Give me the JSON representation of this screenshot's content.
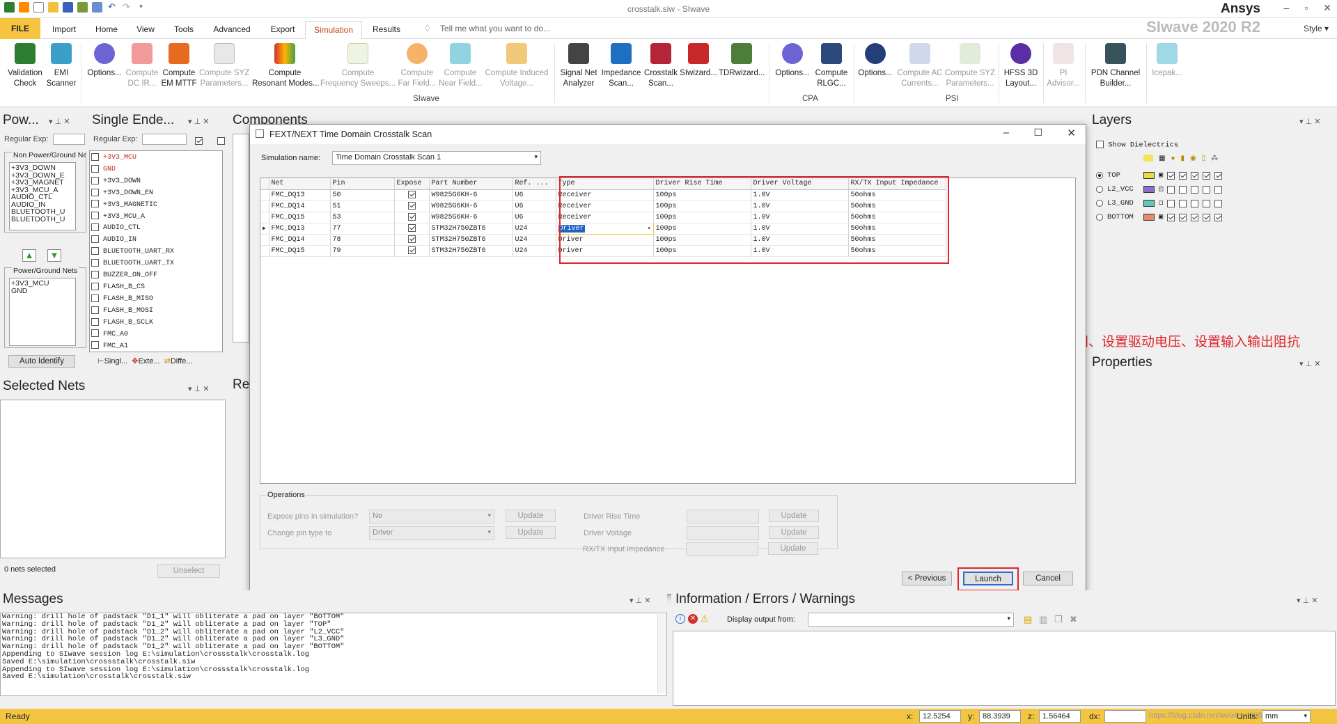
{
  "app": {
    "window_title": "crosstalk.siw - SIwave",
    "brand": "Ansys",
    "product": "SIwave 2020 R2",
    "style_label": "Style"
  },
  "menu": {
    "tabs": [
      "FILE",
      "Import",
      "Home",
      "View",
      "Tools",
      "Advanced",
      "Export",
      "Simulation",
      "Results"
    ],
    "active": "Simulation",
    "tell_me": "Tell me what you want to do..."
  },
  "ribbon": {
    "buttons": [
      {
        "label": "Validation\nCheck",
        "enabled": true,
        "icon": "validation-check-icon"
      },
      {
        "label": "EMI\nScanner",
        "enabled": true,
        "icon": "emi-scanner-icon"
      },
      {
        "label": "Options...",
        "enabled": true,
        "icon": "options-icon"
      },
      {
        "label": "Compute\nDC IR...",
        "enabled": false,
        "icon": "dc-ir-icon"
      },
      {
        "label": "Compute\nEM MTTF",
        "enabled": true,
        "icon": "em-mttf-icon"
      },
      {
        "label": "Compute SYZ\nParameters...",
        "enabled": false,
        "icon": "syz-icon"
      },
      {
        "label": "Compute\nResonant Modes...",
        "enabled": true,
        "icon": "resonant-modes-icon"
      },
      {
        "label": "Compute\nFrequency Sweeps...",
        "enabled": false,
        "icon": "frequency-sweep-icon"
      },
      {
        "label": "Compute\nFar Field...",
        "enabled": false,
        "icon": "far-field-icon"
      },
      {
        "label": "Compute\nNear Field...",
        "enabled": false,
        "icon": "near-field-icon"
      },
      {
        "label": "Compute Induced\nVoltage...",
        "enabled": false,
        "icon": "induced-voltage-icon"
      },
      {
        "label": "Signal Net\nAnalyzer",
        "enabled": true,
        "icon": "signal-net-analyzer-icon"
      },
      {
        "label": "Impedance\nScan...",
        "enabled": true,
        "icon": "impedance-scan-icon"
      },
      {
        "label": "Crosstalk\nScan...",
        "enabled": true,
        "icon": "crosstalk-scan-icon"
      },
      {
        "label": "SIwizard...",
        "enabled": true,
        "icon": "siwizard-icon"
      },
      {
        "label": "TDRwizard...",
        "enabled": true,
        "icon": "tdrwizard-icon"
      },
      {
        "label": "Options...",
        "enabled": true,
        "icon": "cpa-options-icon"
      },
      {
        "label": "Compute\nRLGC...",
        "enabled": true,
        "icon": "rlgc-icon"
      },
      {
        "label": "Options...",
        "enabled": true,
        "icon": "psi-options-icon"
      },
      {
        "label": "Compute AC\nCurrents...",
        "enabled": false,
        "icon": "ac-currents-icon"
      },
      {
        "label": "Compute SYZ\nParameters...",
        "enabled": false,
        "icon": "psi-syz-icon"
      },
      {
        "label": "HFSS 3D\nLayout...",
        "enabled": true,
        "icon": "hfss-3d-layout-icon"
      },
      {
        "label": "PI\nAdvisor...",
        "enabled": false,
        "icon": "pi-advisor-icon"
      },
      {
        "label": "PDN Channel\nBuilder...",
        "enabled": true,
        "icon": "pdn-channel-builder-icon"
      },
      {
        "label": "Icepak...",
        "enabled": false,
        "icon": "icepak-icon"
      }
    ],
    "groups": [
      "SIwave",
      "CPA",
      "PSI"
    ]
  },
  "power_panel": {
    "title": "Pow...",
    "regex_label": "Regular Exp:",
    "nonpower_label": "Non Power/Ground Nets",
    "nonpower_nets": [
      "+3V3_DOWN",
      "+3V3_DOWN_E",
      "+3V3_MAGNET",
      "+3V3_MCU_A",
      "AUDIO_CTL",
      "AUDIO_IN",
      "BLUETOOTH_U",
      "BLUETOOTH_U"
    ],
    "power_label": "Power/Ground Nets",
    "power_nets": [
      "+3V3_MCU",
      "GND"
    ],
    "auto_identify": "Auto Identify"
  },
  "single_ended_panel": {
    "title": "Single Ende...",
    "regex_label": "Regular Exp:",
    "nets": [
      "+3V3_MCU",
      "GND",
      "+3V3_DOWN",
      "+3V3_DOWN_EN",
      "+3V3_MAGNETIC",
      "+3V3_MCU_A",
      "AUDIO_CTL",
      "AUDIO_IN",
      "BLUETOOTH_UART_RX",
      "BLUETOOTH_UART_TX",
      "BUZZER_ON_OFF",
      "FLASH_B_CS",
      "FLASH_B_MISO",
      "FLASH_B_MOSI",
      "FLASH_B_SCLK",
      "FMC_A0",
      "FMC_A1"
    ],
    "tabs": [
      "Singl...",
      "Exte...",
      "Diffe..."
    ]
  },
  "components_panel": {
    "title": "Components",
    "results_title": "Res"
  },
  "selected_nets_panel": {
    "title": "Selected Nets",
    "status": "0 nets selected",
    "unselect": "Unselect"
  },
  "layers_panel": {
    "title": "Layers",
    "show_dielectrics": "Show Dielectrics",
    "layers": [
      {
        "name": "TOP",
        "color": "#e8d94a",
        "selected": true
      },
      {
        "name": "L2_VCC",
        "color": "#8a6fc7",
        "selected": false
      },
      {
        "name": "L3_GND",
        "color": "#5ec7c2",
        "selected": false
      },
      {
        "name": "BOTTOM",
        "color": "#e58a6e",
        "selected": false
      }
    ]
  },
  "properties_panel": {
    "title": "Properties"
  },
  "annotation": {
    "text": "设置驱动端和负载端、设置上升沿时间、设置驱动电压、设置输入输出阻抗",
    "color": "#e0242a"
  },
  "dialog": {
    "title": "FEXT/NEXT Time Domain Crosstalk Scan",
    "sim_name_label": "Simulation name:",
    "sim_name": "Time Domain Crosstalk Scan 1",
    "columns": [
      "Net",
      "Pin",
      "Expose",
      "Part Number",
      "Ref. ...",
      "Type",
      "Driver Rise Time",
      "Driver Voltage",
      "RX/TX Input Impedance"
    ],
    "rows": [
      {
        "net": "FMC_DQ13",
        "pin": "50",
        "expose": true,
        "part": "W9825G6KH-6",
        "ref": "U6",
        "type": "Receiver",
        "rise": "100ps",
        "voltage": "1.0V",
        "impedance": "50ohms"
      },
      {
        "net": "FMC_DQ14",
        "pin": "51",
        "expose": true,
        "part": "W9825G6KH-6",
        "ref": "U6",
        "type": "Receiver",
        "rise": "100ps",
        "voltage": "1.0V",
        "impedance": "50ohms"
      },
      {
        "net": "FMC_DQ15",
        "pin": "53",
        "expose": true,
        "part": "W9825G6KH-6",
        "ref": "U6",
        "type": "Receiver",
        "rise": "100ps",
        "voltage": "1.0V",
        "impedance": "50ohms"
      },
      {
        "net": "FMC_DQ13",
        "pin": "77",
        "expose": true,
        "part": "STM32H750ZBT6",
        "ref": "U24",
        "type": "Driver",
        "rise": "100ps",
        "voltage": "1.0V",
        "impedance": "50ohms"
      },
      {
        "net": "FMC_DQ14",
        "pin": "78",
        "expose": true,
        "part": "STM32H750ZBT6",
        "ref": "U24",
        "type": "Driver",
        "rise": "100ps",
        "voltage": "1.0V",
        "impedance": "50ohms"
      },
      {
        "net": "FMC_DQ15",
        "pin": "79",
        "expose": true,
        "part": "STM32H750ZBT6",
        "ref": "U24",
        "type": "Driver",
        "rise": "100ps",
        "voltage": "1.0V",
        "impedance": "50ohms"
      }
    ],
    "operations": {
      "title": "Operations",
      "expose_label": "Expose pins in simulation?",
      "expose_value": "No",
      "change_type_label": "Change pin type to",
      "change_type_value": "Driver",
      "rise_label": "Driver Rise Time",
      "voltage_label": "Driver Voltage",
      "impedance_label": "RX/TX Input Impedance",
      "update": "Update"
    },
    "previous": "< Previous",
    "launch": "Launch",
    "cancel": "Cancel"
  },
  "messages": {
    "title": "Messages",
    "lines": [
      "Warning: drill hole of padstack \"D1_1\" will obliterate a pad on layer \"BOTTOM\"",
      "Warning: drill hole of padstack \"D1_2\" will obliterate a pad on layer \"TOP\"",
      "Warning: drill hole of padstack \"D1_2\" will obliterate a pad on layer \"L2_VCC\"",
      "Warning: drill hole of padstack \"D1_2\" will obliterate a pad on layer \"L3_GND\"",
      "Warning: drill hole of padstack \"D1_2\" will obliterate a pad on layer \"BOTTOM\"",
      "Appending to SIwave session log E:\\simulation\\crossstalk\\crosstalk.log",
      "Saved E:\\simulation\\crossstalk\\crosstalk.siw",
      "Appending to SIwave session log E:\\simulation\\crossstalk\\crosstalk.log",
      "Saved E:\\simulation\\crosstalk\\crosstalk.siw"
    ]
  },
  "info_panel": {
    "title": "Information / Errors / Warnings",
    "display_from": "Display output from:"
  },
  "status": {
    "ready": "Ready",
    "x_label": "x:",
    "x": "12.5254",
    "y_label": "y:",
    "y": "88.3939",
    "z_label": "z:",
    "z": "1.56464",
    "dx_label": "dx:",
    "units_label": "Units:",
    "units": "mm",
    "watermark": "https://blog.csdn.net/weixin_43058002"
  }
}
